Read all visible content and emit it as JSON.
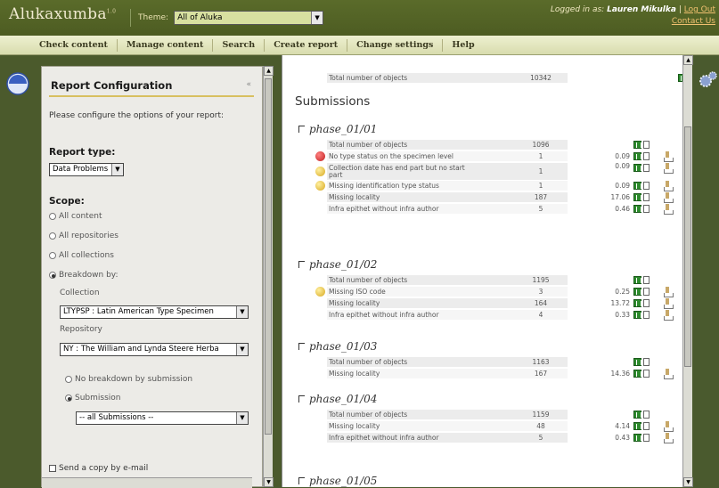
{
  "header": {
    "logo": "Aluka",
    "logo_sub": "xumba",
    "logo_badge": "1.0",
    "theme_label": "Theme:",
    "theme_value": "All of Aluka",
    "logged_in_prefix": "Logged in as:",
    "user": "Lauren Mikulka",
    "logout": "Log Out",
    "contact": "Contact Us"
  },
  "menu": [
    "Check content",
    "Manage content",
    "Search",
    "Create report",
    "Change settings",
    "Help"
  ],
  "panel": {
    "title": "Report Configuration",
    "collapse": "«",
    "intro": "Please configure the options of your report:",
    "report_type_label": "Report type:",
    "report_type_value": "Data Problems",
    "scope_label": "Scope:",
    "scope_options": [
      "All content",
      "All repositories",
      "All collections",
      "Breakdown by:"
    ],
    "collection_label": "Collection",
    "collection_value": "LTYPSP : Latin American Type Specimen",
    "repository_label": "Repository",
    "repository_value": "NY : The William and Lynda Steere Herba",
    "sub_options": [
      "No breakdown by submission",
      "Submission"
    ],
    "submission_value": "-- all Submissions --",
    "email_label": "Send a copy by e-mail"
  },
  "main": {
    "top_row": {
      "label": "Total number of objects",
      "count": "10342"
    },
    "submissions_label": "Submissions",
    "phases": [
      {
        "name": "phase_01/01",
        "rows": [
          {
            "label": "Total number of objects",
            "count": "1096",
            "pct": ""
          },
          {
            "label": "No type status on the specimen level",
            "count": "1",
            "pct": "0.09",
            "icon": "error"
          },
          {
            "label": "Collection date has end part but no start part",
            "count": "1",
            "pct": "0.09",
            "icon": "warning"
          },
          {
            "label": "Missing identification type status",
            "count": "1",
            "pct": "0.09",
            "icon": "warning"
          },
          {
            "label": "Missing locality",
            "count": "187",
            "pct": "17.06"
          },
          {
            "label": "Infra epithet without infra author",
            "count": "5",
            "pct": "0.46"
          }
        ]
      },
      {
        "name": "phase_01/02",
        "rows": [
          {
            "label": "Total number of objects",
            "count": "1195",
            "pct": ""
          },
          {
            "label": "Missing ISO code",
            "count": "3",
            "pct": "0.25",
            "icon": "warning"
          },
          {
            "label": "Missing locality",
            "count": "164",
            "pct": "13.72"
          },
          {
            "label": "Infra epithet without infra author",
            "count": "4",
            "pct": "0.33"
          }
        ]
      },
      {
        "name": "phase_01/03",
        "rows": [
          {
            "label": "Total number of objects",
            "count": "1163",
            "pct": ""
          },
          {
            "label": "Missing locality",
            "count": "167",
            "pct": "14.36"
          }
        ]
      },
      {
        "name": "phase_01/04",
        "rows": [
          {
            "label": "Total number of objects",
            "count": "1159",
            "pct": ""
          },
          {
            "label": "Missing locality",
            "count": "48",
            "pct": "4.14"
          },
          {
            "label": "Infra epithet without infra author",
            "count": "5",
            "pct": "0.43"
          }
        ]
      },
      {
        "name": "phase_01/05",
        "rows": []
      }
    ]
  }
}
